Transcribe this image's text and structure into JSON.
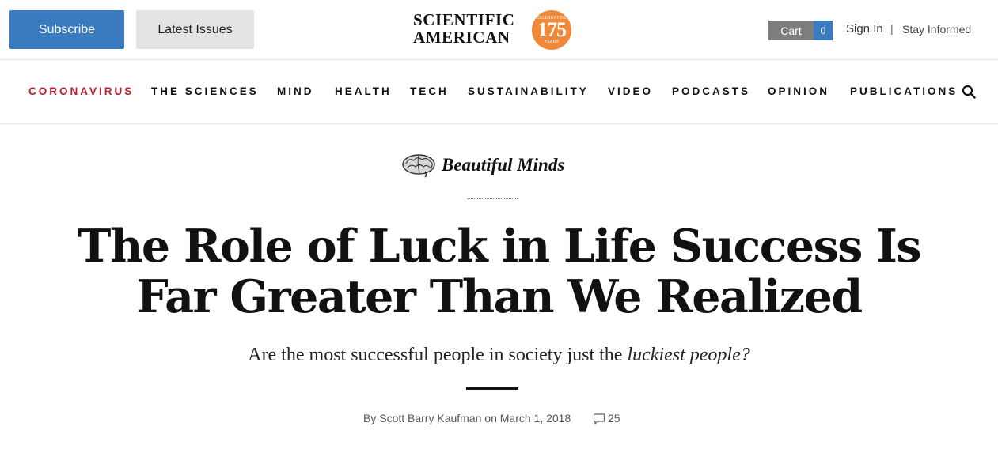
{
  "header": {
    "subscribe_label": "Subscribe",
    "latest_issues_label": "Latest Issues",
    "logo": {
      "line1": "SCIENTIFIC",
      "line2": "AMERICAN",
      "badge_top": "CELEBRATING",
      "badge_number": "175",
      "badge_bottom": "YEARS"
    },
    "cart_label": "Cart",
    "cart_count": "0",
    "sign_in": "Sign In",
    "separator": "|",
    "stay_informed": "Stay Informed"
  },
  "nav": {
    "items": [
      {
        "label": "CORONAVIRUS"
      },
      {
        "label": "THE SCIENCES"
      },
      {
        "label": "MIND"
      },
      {
        "label": "HEALTH"
      },
      {
        "label": "TECH"
      },
      {
        "label": "SUSTAINABILITY"
      },
      {
        "label": "VIDEO"
      },
      {
        "label": "PODCASTS"
      },
      {
        "label": "OPINION"
      },
      {
        "label": "PUBLICATIONS"
      }
    ]
  },
  "article": {
    "column_name": "Beautiful Minds",
    "headline_line1": "The Role of Luck in Life Success Is",
    "headline_line2": "Far Greater Than We Realized",
    "dek_plain": "Are the most successful people in society just the",
    "dek_italic": "luckiest people?",
    "byline": "By Scott Barry Kaufman on March 1, 2018",
    "comment_count": "25"
  },
  "colors": {
    "accent_blue": "#3a7bc0",
    "active_nav_red": "#b8202a",
    "logo_badge_orange": "#f0883a",
    "cart_gray": "#7d7d7d"
  },
  "icons": {
    "search": "search-icon",
    "brain": "brain-icon",
    "comment": "comment-icon"
  }
}
